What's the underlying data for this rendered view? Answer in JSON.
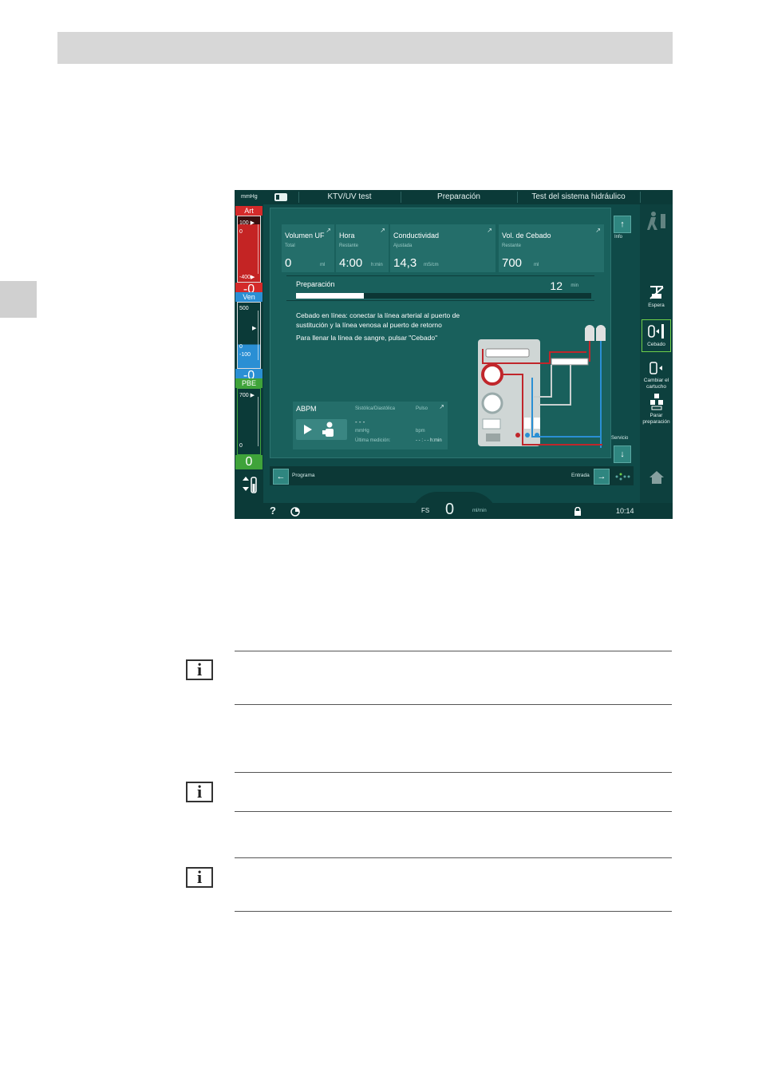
{
  "screen": {
    "topbar": {
      "unit": "mmHg",
      "tab1": "KTV/UV test",
      "tab2": "Preparación",
      "tab3": "Test del sistema hidráulico"
    },
    "left_modules": {
      "art": {
        "label": "Art",
        "top_tick": "100 ▶",
        "zero_tick": "0",
        "bottom_tick": "-400▶",
        "value": "-0",
        "color": "#d42a2a"
      },
      "ven": {
        "label": "Ven",
        "top_tick": "500",
        "zero_tick": "0",
        "bottom_tick": "-100",
        "value": "-0",
        "color": "#2a8fd4"
      },
      "pbe": {
        "label": "PBE",
        "top_tick": "700 ▶",
        "zero_tick": "0",
        "value": "0",
        "color": "#3fa33a"
      }
    },
    "cards": [
      {
        "title": "Volumen UF",
        "sub": "Total",
        "value": "0",
        "unit": "ml"
      },
      {
        "title": "Hora",
        "sub": "Restante",
        "value": "4:00",
        "unit": "h:min"
      },
      {
        "title": "Conductividad",
        "sub": "Ajustada",
        "value": "14,3",
        "unit": "mS/cm"
      },
      {
        "title": "Vol. de Cebado",
        "sub": "Restante",
        "value": "700",
        "unit": "ml"
      }
    ],
    "preparation": {
      "label": "Preparación",
      "time": "12",
      "unit": "min",
      "progress": 0.23
    },
    "message": {
      "line1": "Cebado en línea: conectar la línea arterial al puerto de",
      "line2": "sustitución y la línea venosa al puerto de retorno",
      "line3": "Para llenar la línea de sangre, pulsar \"Cebado\""
    },
    "abpm": {
      "title": "ABPM",
      "col1": "Sistólica/Diastólica",
      "col2": "Pulso",
      "value1": "- - -",
      "unit1": "mmHg",
      "unit2": "bpm",
      "last_label": "Última medición:",
      "last_value": "- - : - -  h:min"
    },
    "scroll": {
      "info": "Info",
      "service": "Servicio"
    },
    "right_panel": {
      "espera": "Espera",
      "cebado": "Cebado",
      "cambiar": "Cambiar el cartucho",
      "parar": "Parar preparación"
    },
    "nav": {
      "back": "Programa",
      "forward": "Entrada"
    },
    "status": {
      "fs": "FS",
      "flow": "0",
      "flow_unit": "ml/min",
      "time": "10:14"
    }
  }
}
